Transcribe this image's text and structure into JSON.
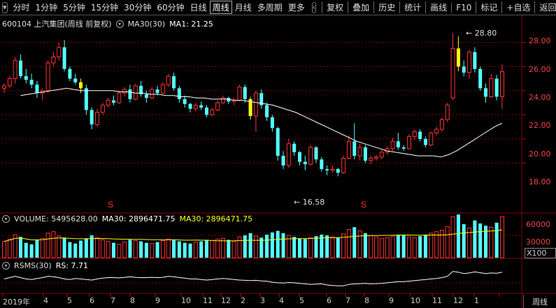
{
  "toolbar": {
    "left_tabs": [
      "分时",
      "1分钟",
      "5分钟",
      "15分钟",
      "30分钟",
      "60分钟",
      "日线",
      "周线",
      "月线",
      "多周期",
      "更多"
    ],
    "active_tab": "周线",
    "right_buttons": [
      "复权",
      "叠加",
      "历史",
      "统计",
      "画线",
      "F10",
      "标记",
      "+自选",
      "返回"
    ]
  },
  "main": {
    "legend_code": "600104 上汽集团(周线 前复权)",
    "legend_ma_label": "MA30(30)",
    "legend_ma_value": "MA1: 21.25",
    "y_ticks": [
      "28.00",
      "26.00",
      "24.00",
      "22.00",
      "20.00",
      "18.00"
    ],
    "high_label": "28.80",
    "low_label": "16.58"
  },
  "volume": {
    "legend_label": "VOLUME: 5495628.00",
    "legend_ma_white": "MA30: 2896471.75",
    "legend_ma_yellow": "MA30: 2896471.75",
    "y_ticks": [
      "60000",
      "30000"
    ],
    "unit": "X100"
  },
  "rsms": {
    "legend_label": "RSMS(30)",
    "legend_value": "RS: 7.71"
  },
  "xaxis": {
    "labels": [
      "2019年",
      "4",
      "5",
      "6",
      "7",
      "8",
      "9",
      "10",
      "11",
      "12",
      "2",
      "3",
      "4",
      "5",
      "6",
      "7",
      "8",
      "9",
      "10",
      "11",
      "12",
      "1"
    ],
    "page_button": "周线"
  },
  "markers": {
    "s_symbol": "S"
  },
  "colors": {
    "up": "#ff3232",
    "down": "#54ffff",
    "highlight": "#ffff00",
    "ma": "#ffffff",
    "grid": "#8b0000"
  },
  "chart_data": {
    "type": "candlestick",
    "y_range": [
      16.0,
      29.2
    ],
    "candles_ohlc": [
      [
        24.2,
        24.6,
        23.8,
        24.4
      ],
      [
        24.4,
        25.2,
        24.2,
        25.0
      ],
      [
        25.0,
        26.8,
        24.6,
        26.5
      ],
      [
        26.5,
        27.0,
        25.0,
        25.2
      ],
      [
        25.2,
        25.8,
        24.6,
        24.9
      ],
      [
        24.9,
        25.4,
        24.2,
        24.5
      ],
      [
        24.5,
        24.8,
        23.4,
        23.8
      ],
      [
        23.8,
        24.2,
        23.2,
        24.0
      ],
      [
        24.0,
        26.5,
        23.8,
        26.3
      ],
      [
        26.3,
        27.2,
        26.0,
        26.8
      ],
      [
        26.8,
        28.0,
        26.5,
        27.6
      ],
      [
        27.6,
        28.2,
        25.6,
        25.8
      ],
      [
        25.8,
        26.0,
        24.8,
        25.0
      ],
      [
        25.0,
        25.4,
        24.5,
        24.7
      ],
      [
        24.7,
        25.0,
        23.8,
        24.2
      ],
      [
        24.2,
        24.5,
        22.0,
        22.4
      ],
      [
        22.4,
        22.6,
        20.8,
        21.2
      ],
      [
        21.2,
        22.5,
        21.0,
        22.2
      ],
      [
        22.2,
        23.0,
        22.0,
        22.8
      ],
      [
        22.8,
        23.4,
        22.6,
        23.2
      ],
      [
        23.2,
        23.6,
        22.8,
        23.0
      ],
      [
        23.0,
        24.0,
        22.9,
        23.8
      ],
      [
        23.8,
        24.3,
        23.5,
        24.1
      ],
      [
        24.1,
        24.5,
        23.0,
        23.3
      ],
      [
        23.3,
        24.6,
        23.2,
        24.4
      ],
      [
        24.4,
        24.8,
        23.5,
        23.7
      ],
      [
        23.7,
        24.0,
        23.0,
        23.4
      ],
      [
        23.4,
        24.3,
        23.3,
        24.1
      ],
      [
        24.1,
        24.4,
        23.6,
        23.8
      ],
      [
        23.8,
        24.7,
        23.7,
        24.5
      ],
      [
        24.5,
        25.4,
        24.3,
        25.2
      ],
      [
        25.2,
        25.5,
        24.0,
        24.2
      ],
      [
        24.2,
        24.4,
        23.0,
        23.3
      ],
      [
        23.3,
        23.6,
        22.6,
        22.9
      ],
      [
        22.9,
        23.0,
        22.2,
        22.5
      ],
      [
        22.5,
        23.0,
        22.3,
        22.8
      ],
      [
        22.8,
        23.1,
        22.4,
        22.6
      ],
      [
        22.6,
        22.8,
        21.8,
        22.0
      ],
      [
        22.0,
        22.6,
        21.9,
        22.4
      ],
      [
        22.4,
        23.2,
        22.3,
        23.0
      ],
      [
        23.0,
        23.6,
        22.9,
        23.4
      ],
      [
        23.4,
        23.5,
        22.9,
        23.1
      ],
      [
        23.1,
        23.4,
        22.8,
        23.2
      ],
      [
        23.2,
        24.5,
        23.1,
        24.3
      ],
      [
        24.3,
        24.5,
        23.0,
        23.3
      ],
      [
        23.3,
        23.5,
        21.6,
        21.9
      ],
      [
        21.9,
        24.0,
        20.6,
        23.8
      ],
      [
        23.8,
        24.1,
        22.5,
        22.8
      ],
      [
        22.8,
        23.0,
        21.5,
        21.8
      ],
      [
        21.8,
        22.0,
        20.6,
        20.9
      ],
      [
        20.9,
        21.0,
        18.2,
        18.6
      ],
      [
        18.6,
        19.0,
        17.5,
        17.8
      ],
      [
        17.8,
        20.0,
        17.6,
        19.6
      ],
      [
        19.6,
        19.8,
        18.6,
        18.9
      ],
      [
        18.9,
        19.0,
        17.8,
        18.1
      ],
      [
        18.1,
        18.6,
        17.4,
        17.9
      ],
      [
        17.9,
        19.5,
        17.8,
        19.3
      ],
      [
        19.3,
        19.4,
        18.0,
        18.3
      ],
      [
        18.3,
        18.5,
        17.3,
        17.5
      ],
      [
        17.5,
        17.8,
        17.0,
        17.4
      ],
      [
        17.4,
        17.8,
        17.2,
        17.5
      ],
      [
        17.5,
        17.6,
        16.9,
        17.2
      ],
      [
        17.2,
        18.6,
        17.1,
        18.4
      ],
      [
        18.4,
        20.3,
        18.3,
        19.8
      ],
      [
        19.8,
        21.3,
        18.3,
        18.6
      ],
      [
        18.6,
        19.6,
        18.2,
        19.3
      ],
      [
        19.3,
        19.5,
        18.0,
        18.2
      ],
      [
        18.2,
        18.6,
        17.9,
        18.4
      ],
      [
        18.4,
        18.7,
        18.2,
        18.5
      ],
      [
        18.5,
        19.1,
        18.3,
        18.9
      ],
      [
        18.9,
        19.4,
        18.7,
        19.2
      ],
      [
        19.2,
        20.1,
        19.0,
        19.8
      ],
      [
        19.8,
        20.5,
        19.1,
        19.3
      ],
      [
        19.3,
        19.5,
        19.0,
        19.2
      ],
      [
        19.2,
        20.4,
        19.1,
        20.2
      ],
      [
        20.2,
        20.8,
        19.9,
        20.6
      ],
      [
        20.6,
        20.8,
        19.8,
        20.0
      ],
      [
        20.0,
        20.2,
        19.3,
        19.5
      ],
      [
        19.5,
        20.6,
        19.4,
        20.5
      ],
      [
        20.5,
        21.0,
        20.3,
        20.8
      ],
      [
        20.8,
        21.8,
        20.6,
        21.6
      ],
      [
        21.6,
        23.0,
        21.4,
        22.8
      ],
      [
        23.4,
        28.8,
        23.2,
        27.5
      ],
      [
        27.5,
        28.5,
        25.6,
        26.0
      ],
      [
        26.0,
        26.5,
        25.2,
        25.5
      ],
      [
        25.5,
        27.4,
        25.0,
        27.2
      ],
      [
        27.2,
        27.6,
        25.5,
        25.8
      ],
      [
        25.8,
        26.0,
        24.0,
        24.2
      ],
      [
        24.2,
        24.6,
        23.0,
        23.5
      ],
      [
        23.5,
        25.4,
        23.4,
        25.0
      ],
      [
        25.0,
        25.3,
        23.2,
        23.5
      ],
      [
        23.5,
        26.2,
        22.5,
        25.6
      ]
    ],
    "highlight_candles": [
      14,
      45,
      83
    ],
    "ma30": [
      23.6,
      23.7,
      23.8,
      23.9,
      24.0,
      24.1,
      24.2,
      24.1,
      24.0,
      24.0,
      24.0,
      24.0,
      24.0,
      23.9,
      23.9,
      23.8,
      23.8,
      23.7,
      23.7,
      23.6,
      23.6,
      23.5,
      23.5,
      23.4,
      23.4,
      23.3,
      23.3,
      23.3,
      23.2,
      23.2,
      23.1,
      23.0,
      22.9,
      22.8,
      22.6,
      22.4,
      22.2,
      21.9,
      21.6,
      21.3,
      21.0,
      20.7,
      20.4,
      20.1,
      19.8,
      19.6,
      19.4,
      19.2,
      19.0,
      18.9,
      18.8,
      18.7,
      18.6,
      18.6,
      18.6,
      18.5,
      18.7,
      19.0,
      19.4,
      19.8,
      20.2,
      20.6,
      21.0,
      21.3
    ],
    "ma30_start_index": 30,
    "volume_values": [
      22000,
      25000,
      31000,
      28000,
      20000,
      18000,
      24000,
      26000,
      33000,
      35000,
      29000,
      27000,
      21000,
      19000,
      23000,
      26000,
      30000,
      27000,
      24000,
      22000,
      20000,
      18000,
      21000,
      24000,
      23000,
      22000,
      20000,
      19000,
      21000,
      23000,
      25000,
      24000,
      22000,
      20000,
      19000,
      21000,
      22000,
      24000,
      23000,
      25000,
      26000,
      24000,
      22000,
      28000,
      30000,
      33000,
      29000,
      27000,
      31000,
      34000,
      36000,
      33000,
      30000,
      28000,
      26000,
      25000,
      27000,
      29000,
      31000,
      30000,
      28000,
      27000,
      32000,
      38000,
      41000,
      36000,
      33000,
      30000,
      28000,
      26000,
      27000,
      29000,
      31000,
      30000,
      28000,
      27000,
      29000,
      31000,
      33000,
      35000,
      37000,
      42000,
      55000,
      58000,
      45000,
      40000,
      50000,
      46000,
      43000,
      41000,
      47000,
      55000
    ],
    "volume_range": [
      0,
      60000
    ],
    "rs_values": [
      7.9,
      7.95,
      8.0,
      7.95,
      7.9,
      7.88,
      7.92,
      7.95,
      8.0,
      7.98,
      7.95,
      7.9,
      7.88,
      7.92,
      7.9,
      7.88,
      7.86,
      7.9,
      7.93,
      7.95,
      7.95,
      7.94,
      7.96,
      7.98,
      7.96,
      7.95,
      7.95,
      7.96,
      7.95,
      7.96,
      8.0,
      7.98,
      7.95,
      7.93,
      7.9,
      7.9,
      7.88,
      7.86,
      7.88,
      7.9,
      7.92,
      7.9,
      7.88,
      7.86,
      7.85,
      7.84,
      7.85,
      7.83,
      7.82,
      7.78,
      7.76,
      7.75,
      7.77,
      7.76,
      7.74,
      7.72,
      7.7,
      7.71,
      7.72,
      7.68,
      7.66,
      7.65,
      7.65,
      7.7,
      7.72,
      7.73,
      7.74,
      7.72,
      7.73,
      7.74,
      7.76,
      7.78,
      7.8,
      7.8,
      7.82,
      7.84,
      7.86,
      7.88,
      7.9,
      7.92,
      7.95,
      8.0,
      8.18,
      8.15,
      8.1,
      8.12,
      8.16,
      8.13,
      8.1,
      8.12,
      8.11,
      8.15
    ],
    "rs_range": [
      7.5,
      8.4
    ]
  }
}
